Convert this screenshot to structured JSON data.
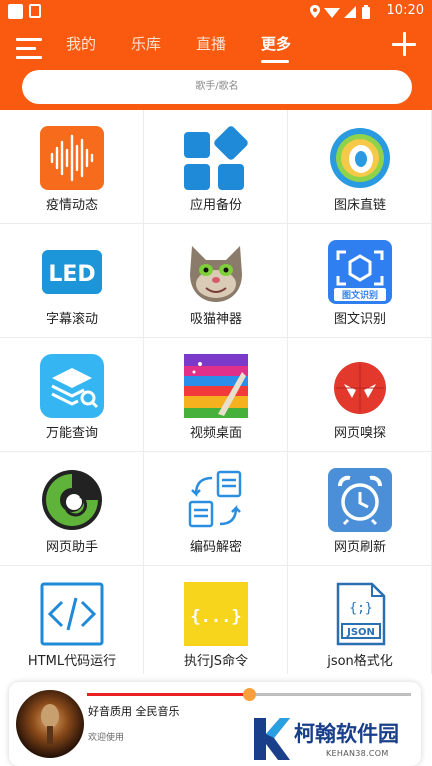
{
  "status_bar": {
    "time": "10:20"
  },
  "header": {
    "tabs": [
      {
        "label": "我的"
      },
      {
        "label": "乐库"
      },
      {
        "label": "直播"
      },
      {
        "label": "更多"
      }
    ],
    "active_tab": "更多",
    "search_placeholder": "歌手/歌名",
    "accent_color": "#f95a10"
  },
  "grid": {
    "items": [
      {
        "label": "疫情动态",
        "icon": "soundwave-icon"
      },
      {
        "label": "应用备份",
        "icon": "app-tiles-icon"
      },
      {
        "label": "图床直链",
        "icon": "ring-logo-icon"
      },
      {
        "label": "字幕滚动",
        "icon": "led-icon"
      },
      {
        "label": "吸猫神器",
        "icon": "talking-cat-icon"
      },
      {
        "label": "图文识别",
        "icon": "ocr-scan-icon",
        "badge": "图文识别"
      },
      {
        "label": "万能查询",
        "icon": "layers-search-icon"
      },
      {
        "label": "视频桌面",
        "icon": "colorful-stripes-icon"
      },
      {
        "label": "网页嗅探",
        "icon": "spider-icon"
      },
      {
        "label": "网页助手",
        "icon": "swirl-logo-icon"
      },
      {
        "label": "编码解密",
        "icon": "document-swap-icon"
      },
      {
        "label": "网页刷新",
        "icon": "alarm-clock-icon"
      },
      {
        "label": "HTML代码运行",
        "icon": "code-brackets-icon"
      },
      {
        "label": "执行JS命令",
        "icon": "js-braces-icon",
        "badge": "{...}"
      },
      {
        "label": "json格式化",
        "icon": "json-file-icon",
        "badge": "JSON"
      }
    ]
  },
  "player": {
    "song": "好音质用 全民音乐",
    "subtitle": "欢迎使用",
    "progress": 0.5
  },
  "watermark": {
    "title": "柯翰软件园",
    "url": "KEHAN38.COM"
  }
}
